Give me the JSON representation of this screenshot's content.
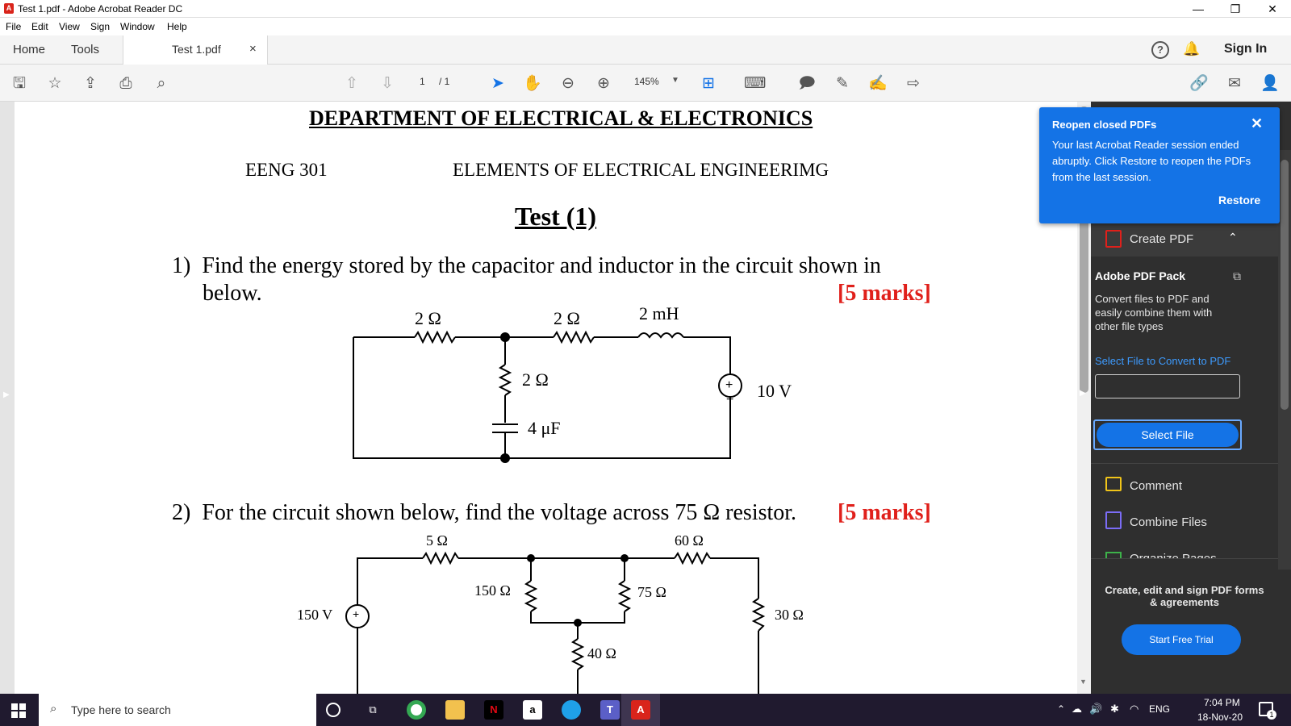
{
  "window": {
    "title": "Test 1.pdf - Adobe Acrobat Reader DC",
    "minimize": "—",
    "restore": "❐",
    "close": "✕"
  },
  "menu": [
    "File",
    "Edit",
    "View",
    "Sign",
    "Window",
    "Help"
  ],
  "tabs": {
    "home": "Home",
    "tools": "Tools",
    "doc": "Test 1.pdf",
    "doc_close": "×",
    "sign_in": "Sign In"
  },
  "toolbar": {
    "page_current": "1",
    "page_total": "/ 1",
    "zoom": "145%"
  },
  "document": {
    "department": "DEPARTMENT OF ELECTRICAL & ELECTRONICS",
    "course_code": "EENG 301",
    "course_name": "ELEMENTS OF ELECTRICAL ENGINEERIMG",
    "test_title": "Test (1)",
    "q1_line1": "1)  Find the energy stored by the capacitor and inductor in the circuit shown in",
    "q1_line2": "below.",
    "q1_marks": "[5 marks]",
    "c1": {
      "r1": "2 Ω",
      "r2": "2 Ω",
      "l": "2 mH",
      "r3": "2 Ω",
      "c": "4 μF",
      "v": "10 V"
    },
    "q2_text": "2)  For the circuit shown below, find the voltage across 75 Ω resistor.",
    "q2_marks": "[5 marks]",
    "c2": {
      "r1": "5 Ω",
      "r2": "60 Ω",
      "r3": "150 Ω",
      "r4": "75 Ω",
      "v": "150 V",
      "r5": "30 Ω",
      "r6": "40 Ω"
    }
  },
  "notification": {
    "title": "Reopen closed PDFs",
    "body": "Your last Acrobat Reader session ended abruptly. Click Restore to reopen the PDFs from the last session.",
    "restore": "Restore"
  },
  "panel": {
    "create_pdf": "Create PDF",
    "pack_title": "Adobe PDF Pack",
    "pack_desc": "Convert files to PDF and easily combine them with other file types",
    "select_link": "Select File to Convert to PDF",
    "select_button": "Select File",
    "comment": "Comment",
    "combine": "Combine Files",
    "organize": "Organize Pages",
    "promo": "Create, edit and sign PDF forms & agreements",
    "trial": "Start Free Trial"
  },
  "taskbar": {
    "search": "Type here to search",
    "lang": "ENG",
    "time": "7:04 PM",
    "date": "18-Nov-20",
    "notif_count": "1"
  },
  "colors": {
    "accent": "#1473e6",
    "marks": "#e0201b",
    "taskbar": "#201a2f",
    "panel": "#2f2f2f"
  }
}
